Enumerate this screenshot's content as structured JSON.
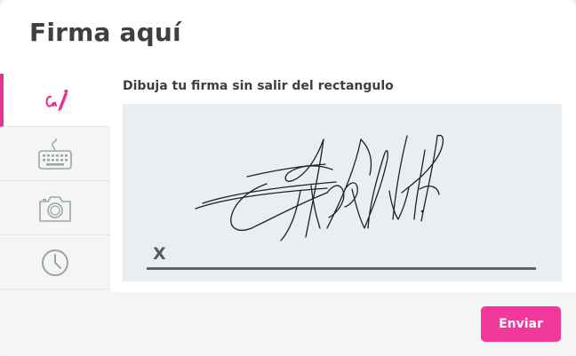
{
  "dialog": {
    "title": "Firma aquí"
  },
  "tabs": [
    {
      "id": "draw",
      "icon": "pen-signature-icon",
      "active": true
    },
    {
      "id": "type",
      "icon": "keyboard-icon",
      "active": false
    },
    {
      "id": "photo",
      "icon": "camera-icon",
      "active": false
    },
    {
      "id": "history",
      "icon": "clock-icon",
      "active": false
    }
  ],
  "canvas": {
    "instruction": "Dibuja tu firma sin salir del rectangulo",
    "x_marker": "X"
  },
  "footer": {
    "send_label": "Enviar"
  },
  "colors": {
    "accent": "#f2399b",
    "canvas_bg": "#e8eef1",
    "text": "#3d3f41"
  }
}
